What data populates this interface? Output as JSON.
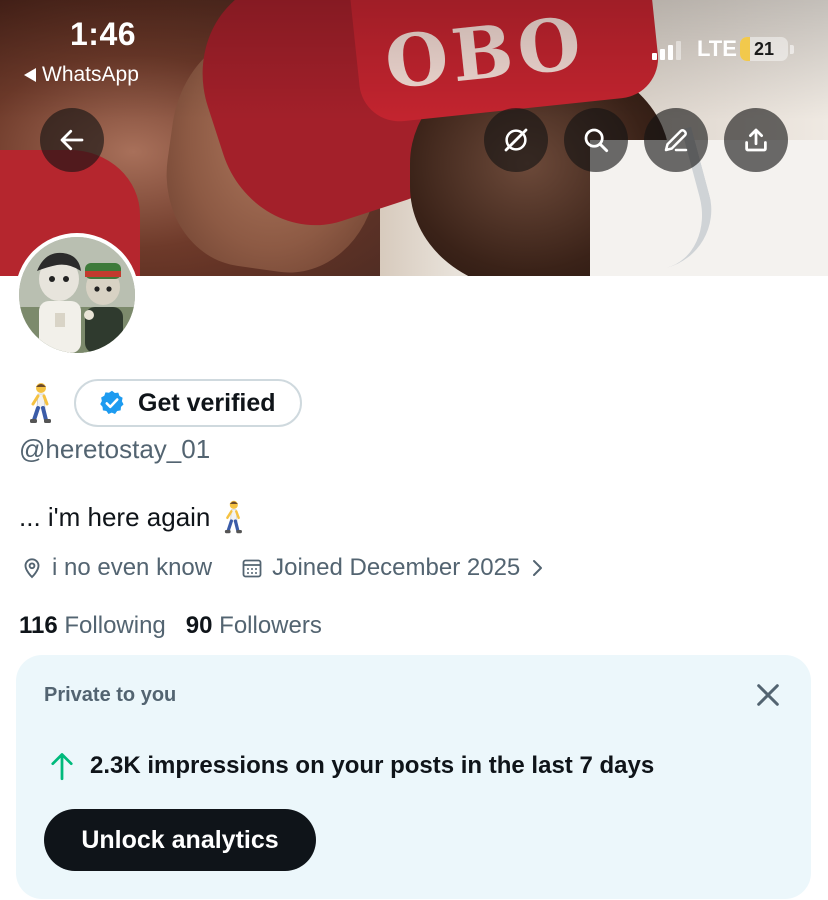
{
  "status_bar": {
    "time": "1:46",
    "back_app": "WhatsApp",
    "network": "LTE",
    "battery": "21",
    "battery_level_percent": 21
  },
  "header_buttons": {
    "back": "arrow-left-icon",
    "grok": "grok-icon",
    "search": "search-icon",
    "edit": "pencil-icon",
    "share": "share-icon"
  },
  "profile": {
    "verify_label": "Get verified",
    "handle": "@heretostay_01",
    "bio": "... i'm here again",
    "location": "i no even know",
    "joined": "Joined December 2025",
    "following_count": "116",
    "following_label": "Following",
    "followers_count": "90",
    "followers_label": "Followers"
  },
  "private_card": {
    "title": "Private to you",
    "impressions": "2.3K impressions on your posts in the last 7 days",
    "button": "Unlock analytics"
  },
  "colors": {
    "accent_green": "#00ba7c",
    "verified_blue": "#1d9bf0",
    "card_bg": "#ecf7fb",
    "text_secondary": "#536471"
  }
}
